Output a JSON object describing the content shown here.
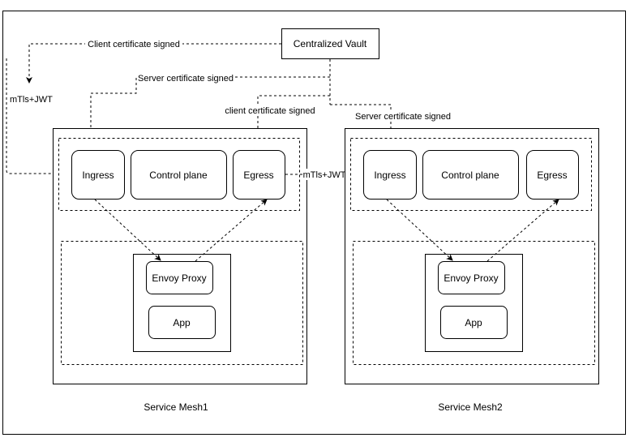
{
  "vault": {
    "label": "Centralized Vault"
  },
  "edges": {
    "client_cert_top": "Client certificate signed",
    "mtls_left": "mTls+JWT",
    "server_cert_mesh1": "Server certificate signed",
    "client_cert_mesh1": "client certificate signed",
    "server_cert_mesh2": "Server certificate signed",
    "mtls_between": "mTls+JWT"
  },
  "meshes": [
    {
      "name": "Service Mesh1",
      "ingress": "Ingress",
      "control_plane": "Control plane",
      "egress": "Egress",
      "proxy": "Envoy Proxy",
      "app": "App"
    },
    {
      "name": "Service Mesh2",
      "ingress": "Ingress",
      "control_plane": "Control plane",
      "egress": "Egress",
      "proxy": "Envoy Proxy",
      "app": "App"
    }
  ]
}
